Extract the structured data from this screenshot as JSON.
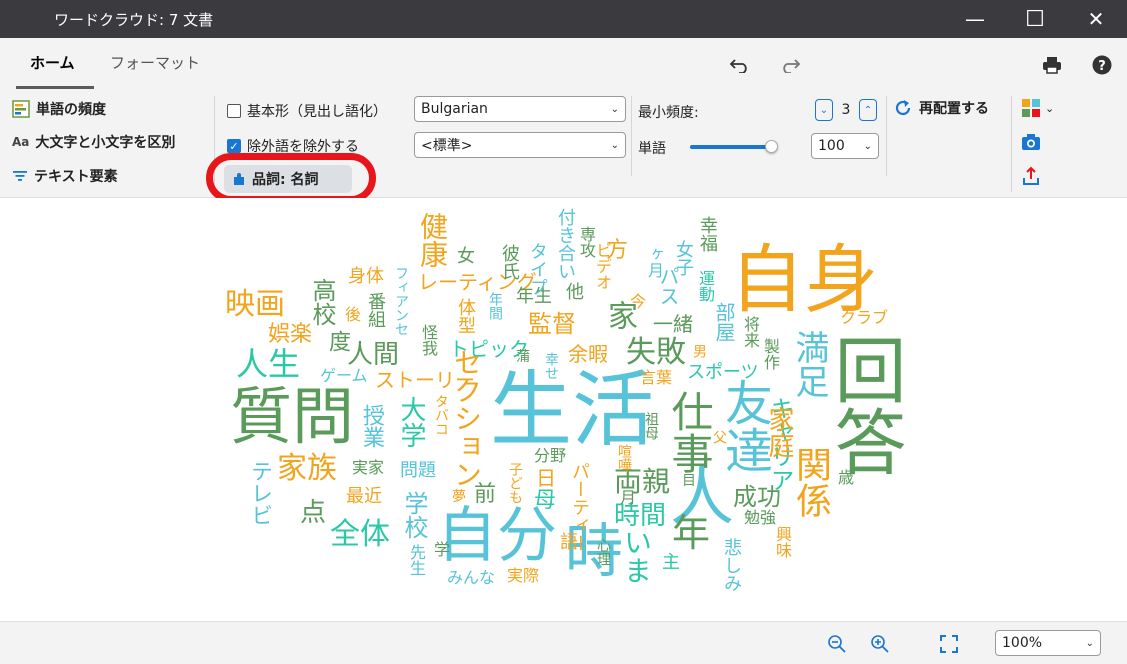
{
  "window": {
    "title": "ワードクラウド: 7 文書",
    "minimize": "—",
    "maximize": "☐",
    "close": "✕"
  },
  "tabs": [
    {
      "label": "ホーム",
      "active": true
    },
    {
      "label": "フォーマット",
      "active": false
    }
  ],
  "ribbon": {
    "word_frequency": "単語の頻度",
    "case_sensitive_prefix": "Aa",
    "case_sensitive": "大文字と小文字を区別",
    "text_elements": "テキスト要素",
    "base_form": "基本形（見出し語化）",
    "base_form_checked": false,
    "exclude_stopwords": "除外語を除外する",
    "exclude_stopwords_checked": true,
    "language": "Bulgarian",
    "stopword_list": "<標準>",
    "pos_filter": "品詞: 名詞",
    "min_freq_label": "最小頻度:",
    "min_freq_value": "3",
    "words_label": "単語",
    "words_slider_fraction": 0.93,
    "words_value": "100",
    "rearrange": "再配置する"
  },
  "status": {
    "zoom": "100%"
  },
  "colors": {
    "green": "#5a9a5a",
    "orange": "#f2a41d",
    "cyan": "#56c3d8",
    "teal": "#2bc8a8",
    "accent": "#1976d2",
    "highlight": "#e8151b"
  },
  "cloud_words": [
    "生活",
    "質問",
    "自分",
    "回答",
    "自身",
    "人",
    "友達",
    "時",
    "仕事",
    "年",
    "映画",
    "人生",
    "家族",
    "全体",
    "点",
    "学校",
    "大学",
    "セクション",
    "健康",
    "関係",
    "満足",
    "家",
    "監督",
    "失敗",
    "両親",
    "時間",
    "いま",
    "成功",
    "キャリア",
    "家庭",
    "人間",
    "ストーリー",
    "トピック",
    "レーティング",
    "高校",
    "度",
    "娯楽",
    "ゲーム",
    "テレビ",
    "問題",
    "最近",
    "実家",
    "授業",
    "身体",
    "番組",
    "後",
    "フィアンセ",
    "怪我",
    "体型",
    "年生",
    "他",
    "余暇",
    "方",
    "今",
    "ビデオ",
    "パス",
    "ヶ月",
    "女子",
    "運動",
    "幸福",
    "部屋",
    "将来",
    "クラブ",
    "スポーツ",
    "言葉",
    "男",
    "製作",
    "祖母",
    "父",
    "勉強",
    "興味",
    "悲しみ",
    "主",
    "目",
    "月",
    "パーティー",
    "母",
    "日",
    "分野",
    "子ども",
    "前",
    "夢",
    "タバコ",
    "語",
    "心理",
    "先生",
    "学",
    "みんな",
    "実際",
    "喧嘩",
    "彼氏",
    "女",
    "タイプ",
    "付き合い",
    "専攻",
    "一緒",
    "年間",
    "蒲",
    "幸せ",
    "歳"
  ]
}
